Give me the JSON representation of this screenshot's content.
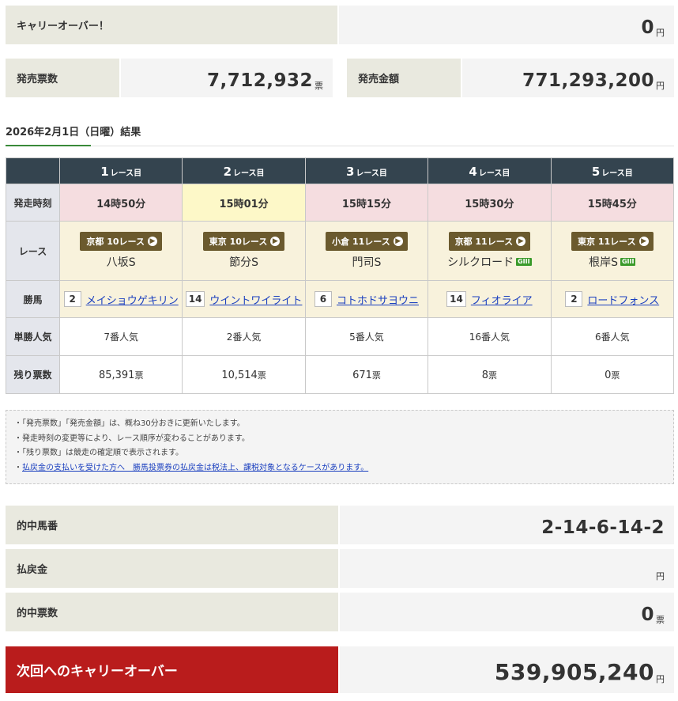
{
  "carryover": {
    "label": "キャリーオーバー！",
    "value": "0",
    "unit": "円"
  },
  "sales_count": {
    "label": "発売票数",
    "value": "7,712,932",
    "unit": "票"
  },
  "sales_amount": {
    "label": "発売金額",
    "value": "771,293,200",
    "unit": "円"
  },
  "results_title": "2026年2月1日（日曜）結果",
  "table": {
    "row_labels": {
      "time": "発走時刻",
      "race": "レース",
      "winner": "勝馬",
      "popularity": "単勝人気",
      "remaining": "残り票数"
    },
    "races": [
      {
        "num": "1",
        "suffix": "レース目",
        "time": "14時50分",
        "venue": "京都 10レース",
        "name": "八坂S",
        "grade": "",
        "horse_no": "2",
        "horse": "メイショウゲキリン",
        "popularity": "7番人気",
        "remaining": "85,391",
        "remaining_unit": "票"
      },
      {
        "num": "2",
        "suffix": "レース目",
        "time": "15時01分",
        "venue": "東京 10レース",
        "name": "節分S",
        "grade": "",
        "horse_no": "14",
        "horse": "ウイントワイライト",
        "popularity": "2番人気",
        "remaining": "10,514",
        "remaining_unit": "票"
      },
      {
        "num": "3",
        "suffix": "レース目",
        "time": "15時15分",
        "venue": "小倉 11レース",
        "name": "門司S",
        "grade": "",
        "horse_no": "6",
        "horse": "コトホドサヨウニ",
        "popularity": "5番人気",
        "remaining": "671",
        "remaining_unit": "票"
      },
      {
        "num": "4",
        "suffix": "レース目",
        "time": "15時30分",
        "venue": "京都 11レース",
        "name": "シルクロード",
        "grade": "GIII",
        "horse_no": "14",
        "horse": "フィオライア",
        "popularity": "16番人気",
        "remaining": "8",
        "remaining_unit": "票"
      },
      {
        "num": "5",
        "suffix": "レース目",
        "time": "15時45分",
        "venue": "東京 11レース",
        "name": "根岸S",
        "grade": "GIII",
        "horse_no": "2",
        "horse": "ロードフォンス",
        "popularity": "6番人気",
        "remaining": "0",
        "remaining_unit": "票"
      }
    ]
  },
  "notes": [
    "「発売票数」「発売金額」は、概ね30分おきに更新いたします。",
    "発走時刻の変更等により、レース順序が変わることがあります。",
    "「残り票数」は競走の確定順で表示されます。"
  ],
  "notes_link": "払戻金の支払いを受けた方へ　勝馬投票券の払戻金は税法上、課税対象となるケースがあります。",
  "hit_numbers": {
    "label": "的中馬番",
    "value": "2-14-6-14-2"
  },
  "payout": {
    "label": "払戻金",
    "value": "",
    "unit": "円"
  },
  "hit_count": {
    "label": "的中票数",
    "value": "0",
    "unit": "票"
  },
  "next_carryover": {
    "label": "次回へのキャリーオーバー",
    "value": "539,905,240",
    "unit": "円"
  },
  "colors": {
    "header_bg": "#34444f",
    "accent_red": "#b91c1c",
    "venue_badge": "#6b5a2e",
    "grade_green": "#3a9a2a",
    "link": "#1a3fbf"
  },
  "icons": {
    "venue_arrow": "chevron-right-circle-icon"
  }
}
